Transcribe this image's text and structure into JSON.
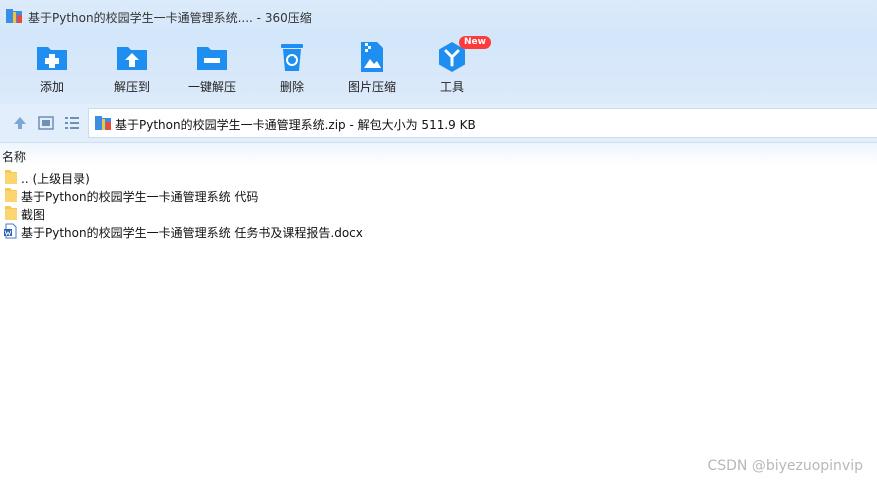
{
  "window": {
    "title": "基于Python的校园学生一卡通管理系统.... - 360压缩"
  },
  "toolbar": {
    "items": [
      {
        "label": "添加",
        "icon": "add-folder-icon"
      },
      {
        "label": "解压到",
        "icon": "extract-to-icon"
      },
      {
        "label": "一键解压",
        "icon": "one-click-extract-icon"
      },
      {
        "label": "删除",
        "icon": "recycle-bin-icon"
      },
      {
        "label": "图片压缩",
        "icon": "image-compress-icon"
      },
      {
        "label": "工具",
        "icon": "tools-icon",
        "badge": "New"
      }
    ]
  },
  "address": {
    "path": "基于Python的校园学生一卡通管理系统.zip - 解包大小为 511.9 KB"
  },
  "columns": {
    "name": "名称"
  },
  "files": [
    {
      "name": ".. (上级目录)",
      "icon": "folder-icon"
    },
    {
      "name": "基于Python的校园学生一卡通管理系统 代码",
      "icon": "folder-icon"
    },
    {
      "name": "截图",
      "icon": "folder-icon"
    },
    {
      "name": "基于Python的校园学生一卡通管理系统 任务书及课程报告.docx",
      "icon": "word-document-icon"
    }
  ],
  "watermark": "CSDN @biyezuopinvip",
  "colors": {
    "accent": "#1e8ff0",
    "titlebar": "#d3e6fa",
    "badge": "#ff3b3b",
    "folder": "#f6c85a"
  }
}
